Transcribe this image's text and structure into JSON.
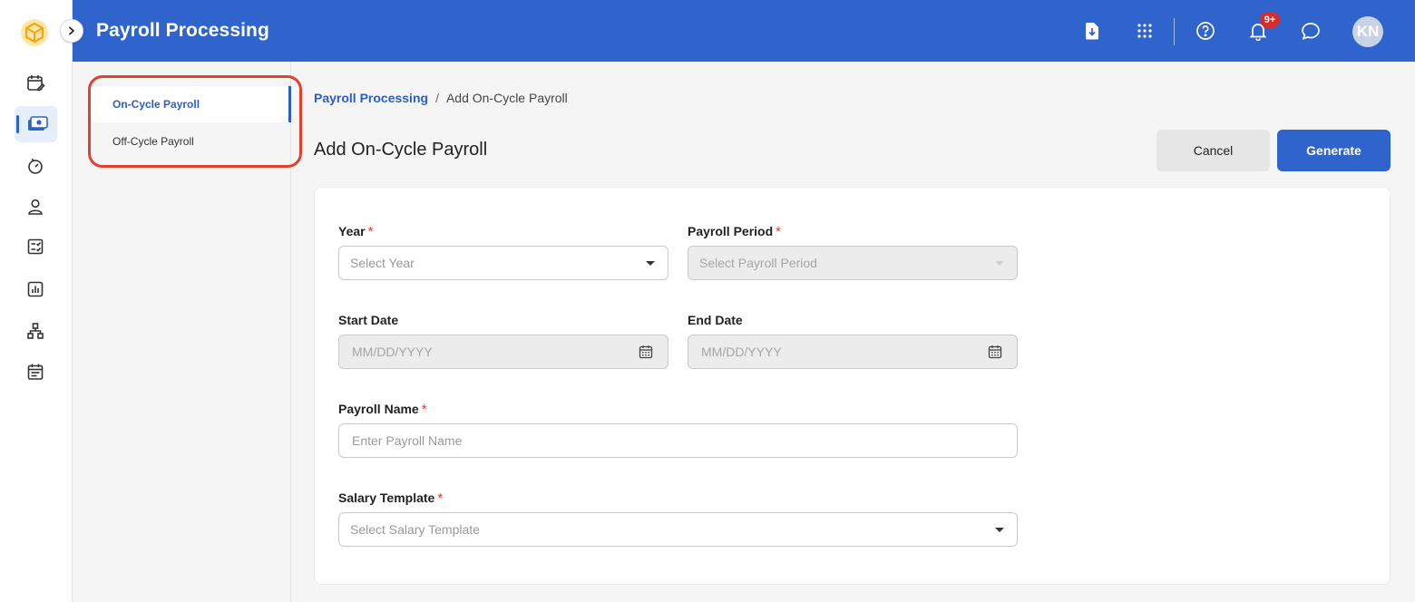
{
  "app": {
    "title": "Payroll Processing"
  },
  "header": {
    "notification_badge": "9+",
    "avatar_initials": "KN"
  },
  "sidebar": {
    "icons": [
      "calendar-edit-icon",
      "payroll-money-icon",
      "timer-icon",
      "person-icon",
      "checklist-icon",
      "report-chart-icon",
      "org-chart-icon",
      "schedule-icon"
    ],
    "active_index": 1
  },
  "subnav": {
    "items": [
      {
        "label": "On-Cycle Payroll",
        "active": true
      },
      {
        "label": "Off-Cycle Payroll",
        "active": false
      }
    ]
  },
  "breadcrumb": {
    "root": "Payroll Processing",
    "separator": "/",
    "current": "Add On-Cycle Payroll"
  },
  "page": {
    "title": "Add On-Cycle Payroll",
    "cancel_label": "Cancel",
    "generate_label": "Generate"
  },
  "form": {
    "year": {
      "label": "Year",
      "required": "*",
      "placeholder": "Select Year"
    },
    "payroll_period": {
      "label": "Payroll Period",
      "required": "*",
      "placeholder": "Select Payroll Period"
    },
    "start_date": {
      "label": "Start Date",
      "placeholder": "MM/DD/YYYY"
    },
    "end_date": {
      "label": "End Date",
      "placeholder": "MM/DD/YYYY"
    },
    "payroll_name": {
      "label": "Payroll Name",
      "required": "*",
      "placeholder": "Enter Payroll Name"
    },
    "salary_template": {
      "label": "Salary Template",
      "required": "*",
      "placeholder": "Select Salary Template"
    }
  },
  "colors": {
    "brand": "#2e64cc",
    "required": "#e0412f",
    "highlight_ring": "#e0412f"
  }
}
